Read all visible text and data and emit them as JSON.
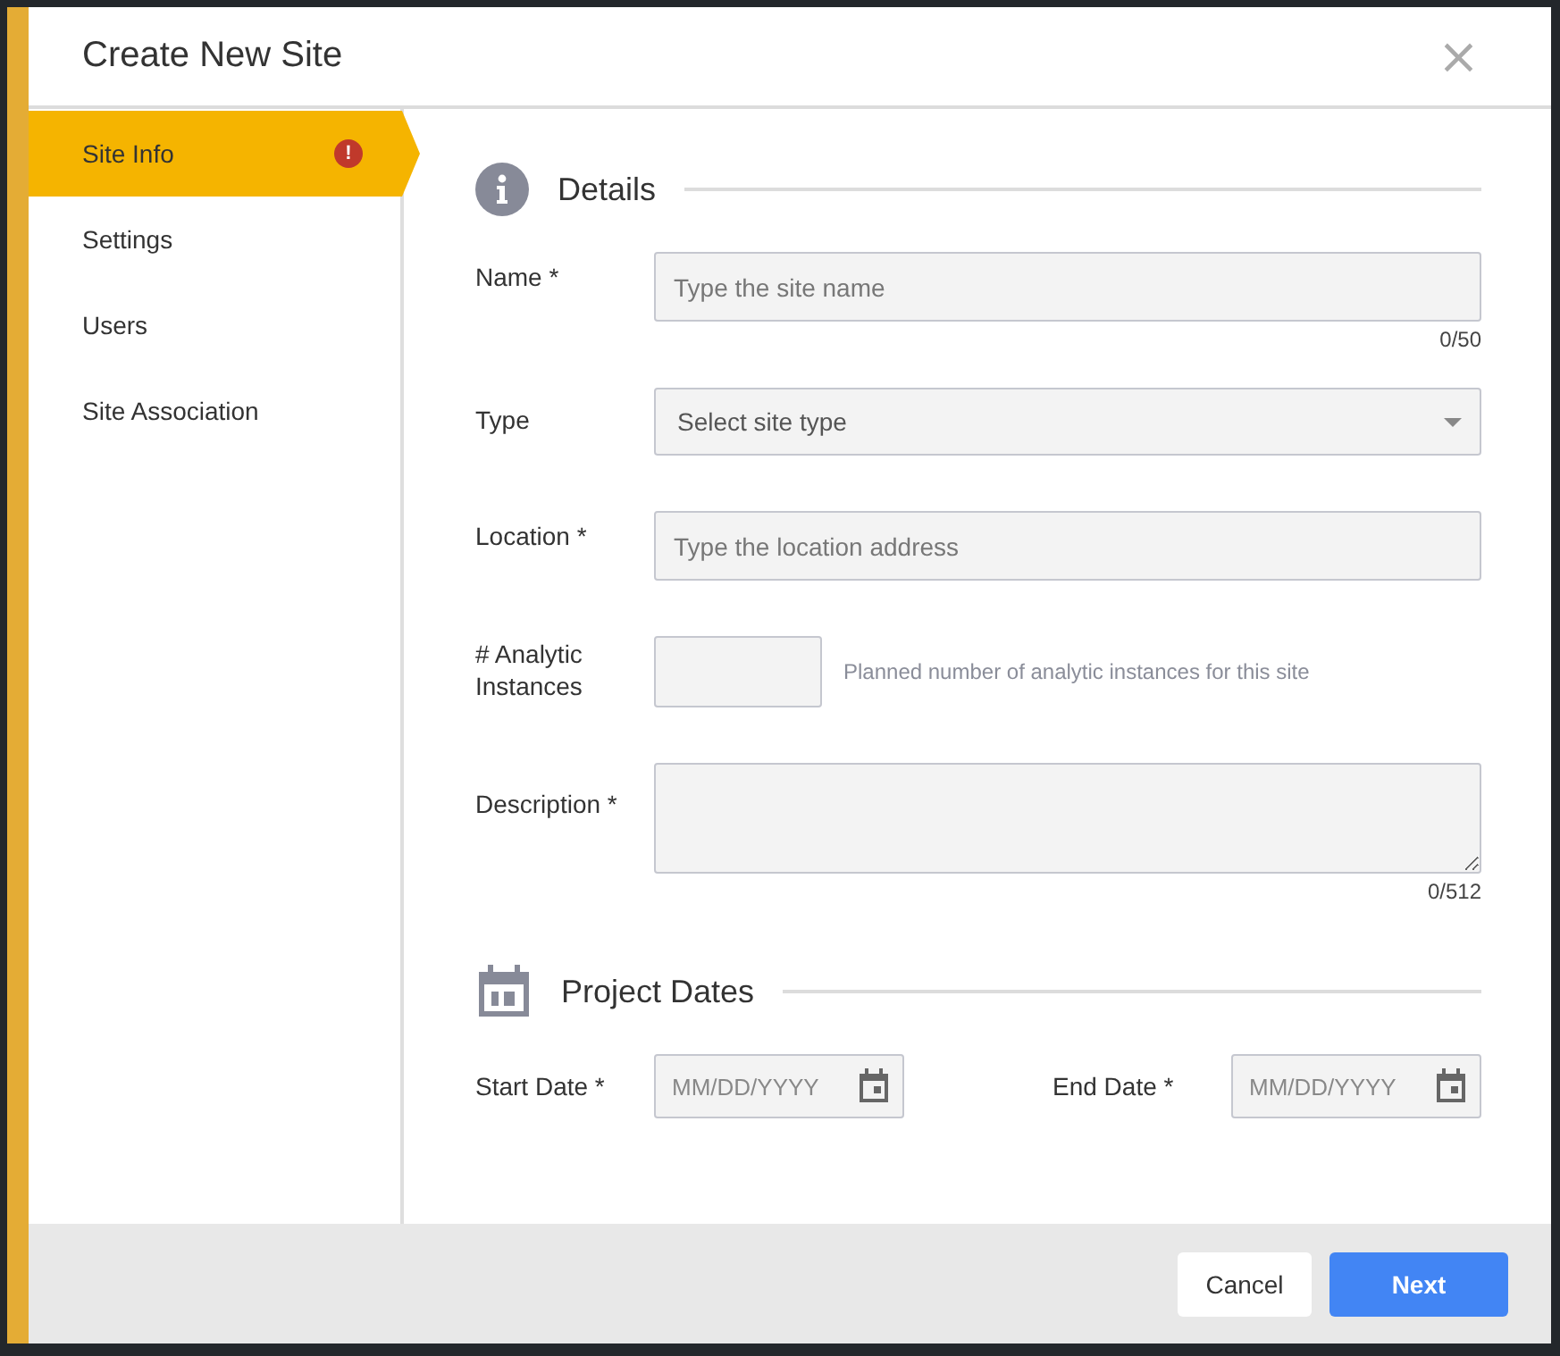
{
  "dialog": {
    "title": "Create New Site",
    "close": "×"
  },
  "sidebar": {
    "items": [
      {
        "label": "Site Info",
        "selected": true,
        "alert": true,
        "alert_mark": "!"
      },
      {
        "label": "Settings",
        "selected": false,
        "alert": false
      },
      {
        "label": "Users",
        "selected": false,
        "alert": false
      },
      {
        "label": "Site Association",
        "selected": false,
        "alert": false
      }
    ]
  },
  "details": {
    "heading": "Details",
    "fields": [
      {
        "kind": "text",
        "label": "Name *",
        "placeholder": "Type the site name",
        "counter": "0/50"
      },
      {
        "kind": "select",
        "label": "Type",
        "placeholder": "Select site type"
      },
      {
        "kind": "text",
        "label": "Location *",
        "placeholder": "Type the location address"
      },
      {
        "kind": "number",
        "label": "# Analytic Instances",
        "hint": "Planned number of analytic instances for this site"
      },
      {
        "kind": "textarea",
        "label": "Description *",
        "counter": "0/512"
      }
    ]
  },
  "project_dates": {
    "heading": "Project Dates",
    "fields": [
      {
        "label": "Start Date *",
        "placeholder": "MM/DD/YYYY"
      },
      {
        "label": "End Date *",
        "placeholder": "MM/DD/YYYY"
      }
    ]
  },
  "footer": {
    "buttons": [
      {
        "label": "Cancel",
        "kind": "secondary"
      },
      {
        "label": "Next",
        "kind": "primary"
      }
    ]
  }
}
